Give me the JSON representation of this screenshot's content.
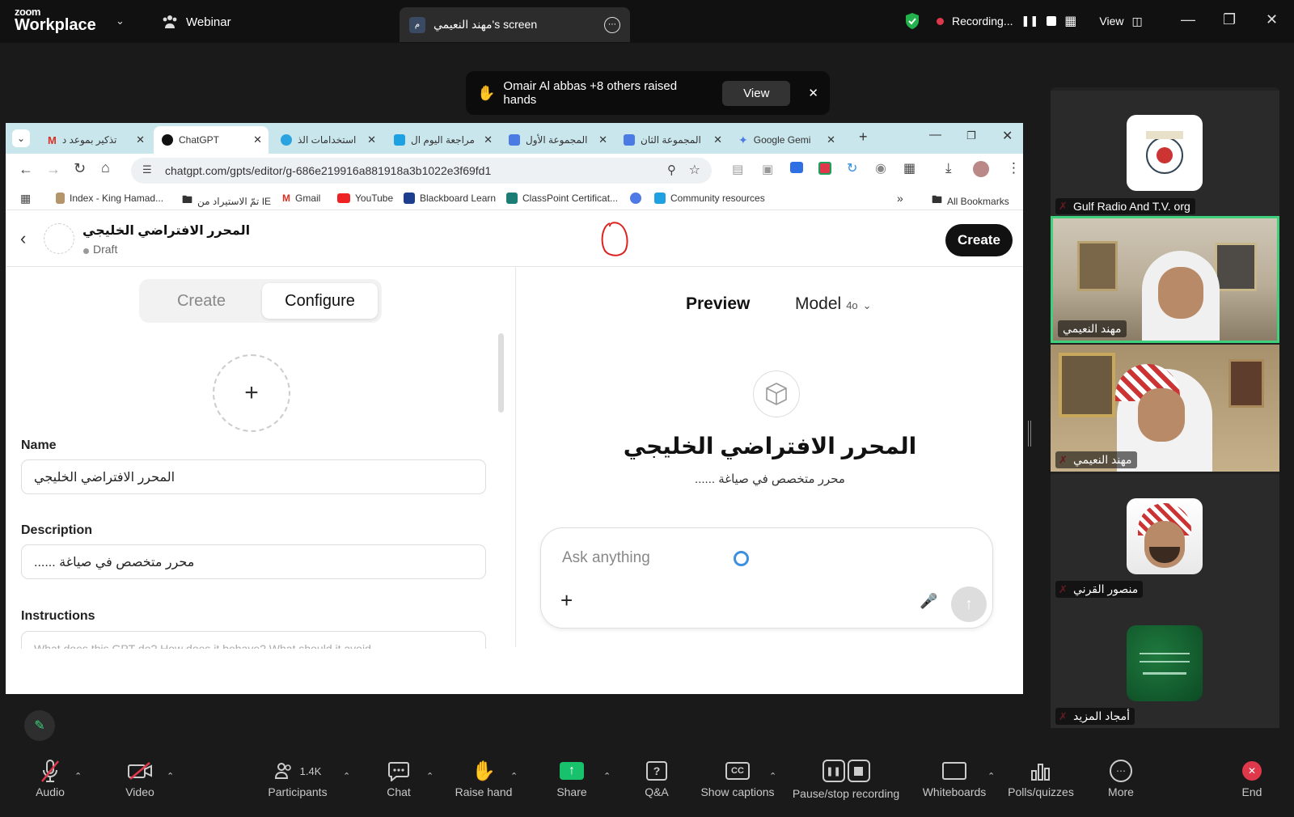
{
  "zoom": {
    "logo_small": "zoom",
    "logo_big": "Workplace",
    "webinar_label": "Webinar",
    "share_tab_title": "مهند النعيمي's screen",
    "share_tab_avatar": "م",
    "recording_label": "Recording...",
    "view_label": "View",
    "raised_hands_text": "Omair Al abbas +8 others raised hands",
    "raised_hands_view": "View"
  },
  "browser": {
    "tabs": [
      {
        "label": "تذكير بموعد د",
        "icon": "gmail-icon",
        "color": "#d93025"
      },
      {
        "label": "ChatGPT",
        "icon": "chatgpt-icon",
        "color": "#111111"
      },
      {
        "label": "استخدامات الذ",
        "icon": "telegram-icon",
        "color": "#2aa3e0"
      },
      {
        "label": "مراجعة اليوم ال",
        "icon": "grid-icon",
        "color": "#1ea1e3"
      },
      {
        "label": "المجموعة الأول",
        "icon": "docs-icon",
        "color": "#4a7be5"
      },
      {
        "label": "المجموعة الثان",
        "icon": "docs-icon",
        "color": "#4a7be5"
      },
      {
        "label": "Google Gemi",
        "icon": "gemini-icon",
        "color": "#4f79e6"
      }
    ],
    "url": "chatgpt.com/gpts/editor/g-686e219916a881918a3b1022e3f69fd1",
    "bookmarks": [
      {
        "label": "Index - King Hamad..."
      },
      {
        "label": "تمّ الاستيراد من IE"
      },
      {
        "label": "Gmail"
      },
      {
        "label": "YouTube"
      },
      {
        "label": "Blackboard Learn"
      },
      {
        "label": "ClassPoint Certificat..."
      },
      {
        "label": "Community resources"
      }
    ],
    "all_bookmarks": "All Bookmarks"
  },
  "gpt": {
    "title": "المحرر الافتراضي الخليجي",
    "status": "Draft",
    "create_button": "Create",
    "tab_create": "Create",
    "tab_configure": "Configure",
    "name_label": "Name",
    "name_value": "المحرر الافتراضي الخليجي",
    "description_label": "Description",
    "description_value": "محرر متخصص في صياغة ......",
    "instructions_label": "Instructions",
    "instructions_placeholder": "What does this GPT do? How does it behave? What should it avoid",
    "preview_label": "Preview",
    "model_label": "Model",
    "model_value": "4o",
    "preview_title": "المحرر الافتراضي الخليجي",
    "preview_desc": "محرر متخصص في صياغة ......",
    "composer_placeholder": "Ask anything"
  },
  "gallery": [
    {
      "name": "Gulf Radio And T.V. org",
      "type": "logo"
    },
    {
      "name": "مهند النعيمي",
      "type": "video",
      "active": true
    },
    {
      "name": "مهند النعيمي",
      "type": "video"
    },
    {
      "name": "منصور القرني",
      "type": "avatar"
    },
    {
      "name": "أمجاد المزيد",
      "type": "flag"
    }
  ],
  "toolbar": {
    "audio": "Audio",
    "video": "Video",
    "participants": "Participants",
    "participants_count": "1.4K",
    "chat": "Chat",
    "raise_hand": "Raise hand",
    "share": "Share",
    "qa": "Q&A",
    "captions": "Show captions",
    "pause_stop": "Pause/stop recording",
    "whiteboards": "Whiteboards",
    "polls": "Polls/quizzes",
    "more": "More",
    "end": "End"
  },
  "colors": {
    "zoom_bg": "#1a1a1a",
    "share_green": "#18c26c",
    "active_speaker": "#3ed07a",
    "muted_red": "#e0384b"
  }
}
